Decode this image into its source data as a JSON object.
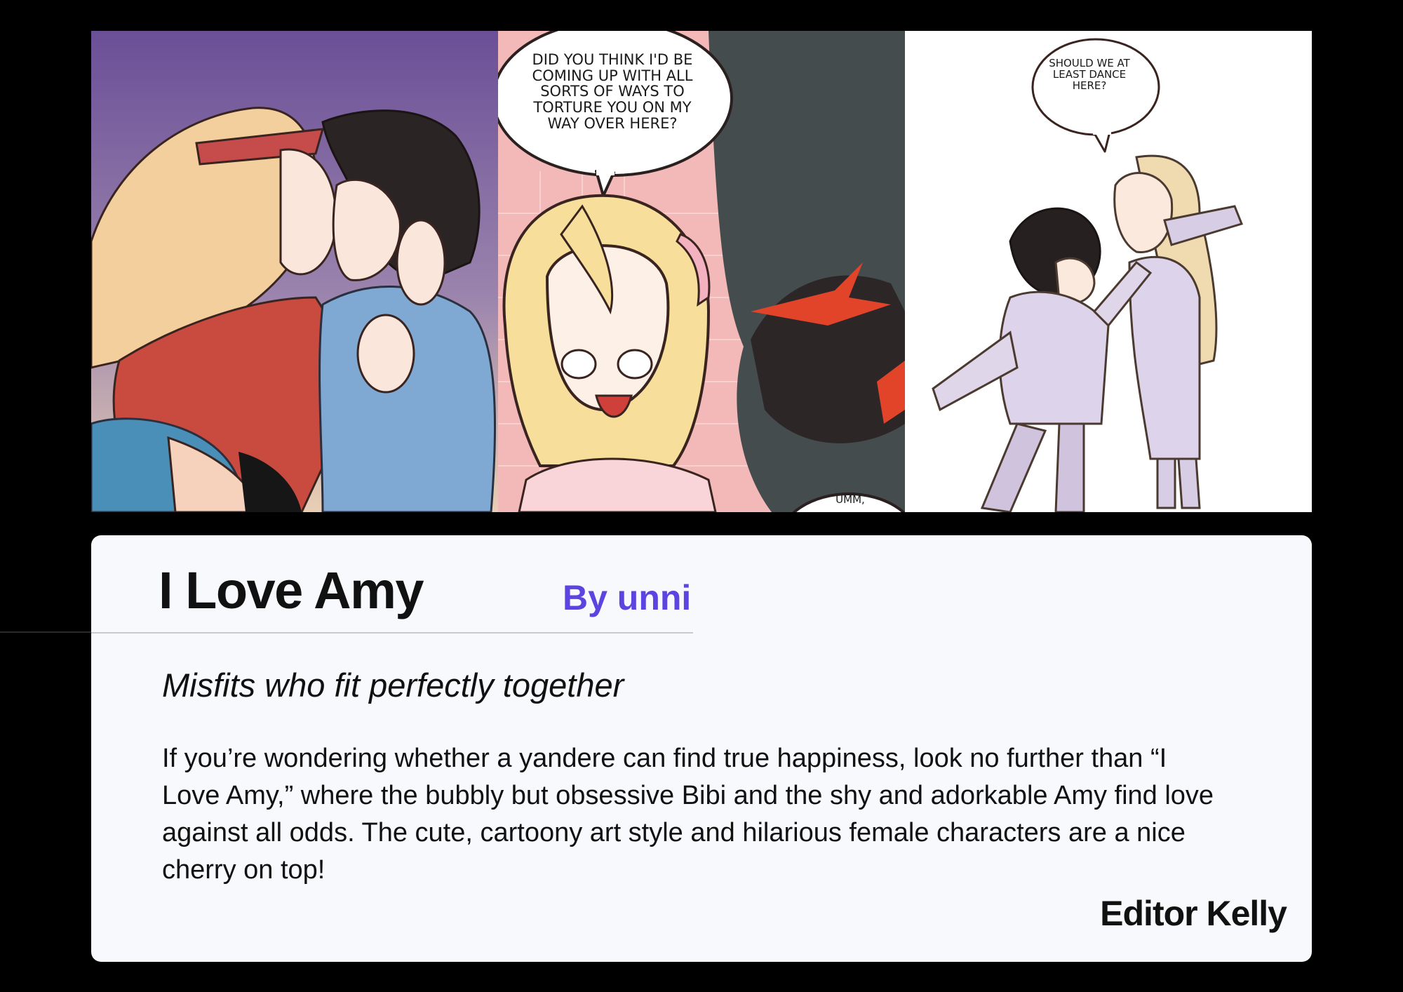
{
  "panels": {
    "bubble_1": "Did you think I'd be coming up with all sorts of ways to torture you on my way over here?",
    "bubble_2": "Should we at least dance here?",
    "bubble_3": "Umm,"
  },
  "card": {
    "title": "I Love Amy",
    "byline": "By unni",
    "tagline": "Misfits who fit perfectly together",
    "description": "If you’re wondering whether a yandere can find true happiness, look no further than “I Love Amy,” where the bubbly but obsessive Bibi and the shy and adorkable Amy find love against all odds. The cute, cartoony art style and hilarious female characters are a nice cherry on top!",
    "signature": "Editor Kelly"
  },
  "colors": {
    "background": "#000000",
    "card": "#f8f9fc",
    "byline": "#5b45e0",
    "text": "#111111"
  }
}
